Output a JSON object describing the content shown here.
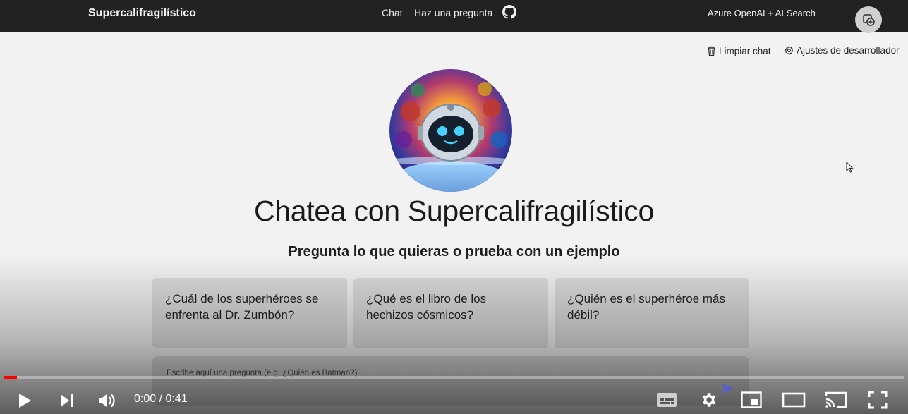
{
  "header": {
    "brand": "Supercalifragilístico",
    "nav": [
      "Chat",
      "Haz una pregunta"
    ],
    "search_label": "Azure OpenAI + AI Search"
  },
  "commands": {
    "clear": "Limpiar chat",
    "settings": "Ajustes de desarrollador"
  },
  "hero": {
    "title": "Chatea con Supercalifragilístico",
    "subtitle": "Pregunta lo que quieras o prueba con un ejemplo"
  },
  "examples": [
    "¿Cuál de los superhéroes se enfrenta al Dr. Zumbón?",
    "¿Qué es el libro de los hechizos cósmicos?",
    "¿Quién es el superhéroe más débil?"
  ],
  "question": {
    "placeholder": "Escribe aquí una pregunta (e.g. ¿Quién es Batman?)"
  },
  "player": {
    "time": "0:00 / 0:41",
    "progress_fraction": 0.014,
    "accent": "#ff0000"
  },
  "icons": [
    "github-icon",
    "trash-icon",
    "gear-icon",
    "play-icon",
    "next-icon",
    "volume-icon",
    "subtitles-icon",
    "settings-icon",
    "miniplayer-icon",
    "theater-icon",
    "cast-icon",
    "fullscreen-icon",
    "send-icon"
  ]
}
